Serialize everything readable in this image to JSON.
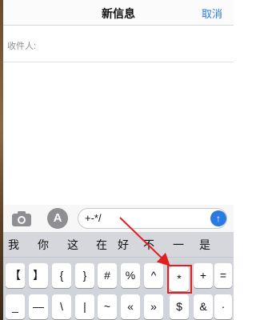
{
  "nav": {
    "title": "新信息",
    "cancel_label": "取消"
  },
  "recipient": {
    "label": "收件人:"
  },
  "composer": {
    "camera_icon": "camera-icon",
    "appstore_icon": "app-store-icon",
    "appstore_glyph": "A",
    "message_text": "+-*/",
    "send_icon": "arrow-up-icon",
    "send_glyph": "↑"
  },
  "candidates": [
    "我",
    "你",
    "这",
    "在",
    "好",
    "不",
    "一",
    "是"
  ],
  "keyboard": {
    "row1": [
      "【",
      "】",
      "{",
      "}",
      "#",
      "%",
      "^",
      "*",
      "+",
      "="
    ],
    "row2": [
      "_",
      "—",
      "\\",
      "|",
      "~",
      "«",
      "»",
      "$",
      "&",
      "·"
    ]
  },
  "colors": {
    "accent": "#2a7ae2",
    "highlight": "#e02020"
  }
}
